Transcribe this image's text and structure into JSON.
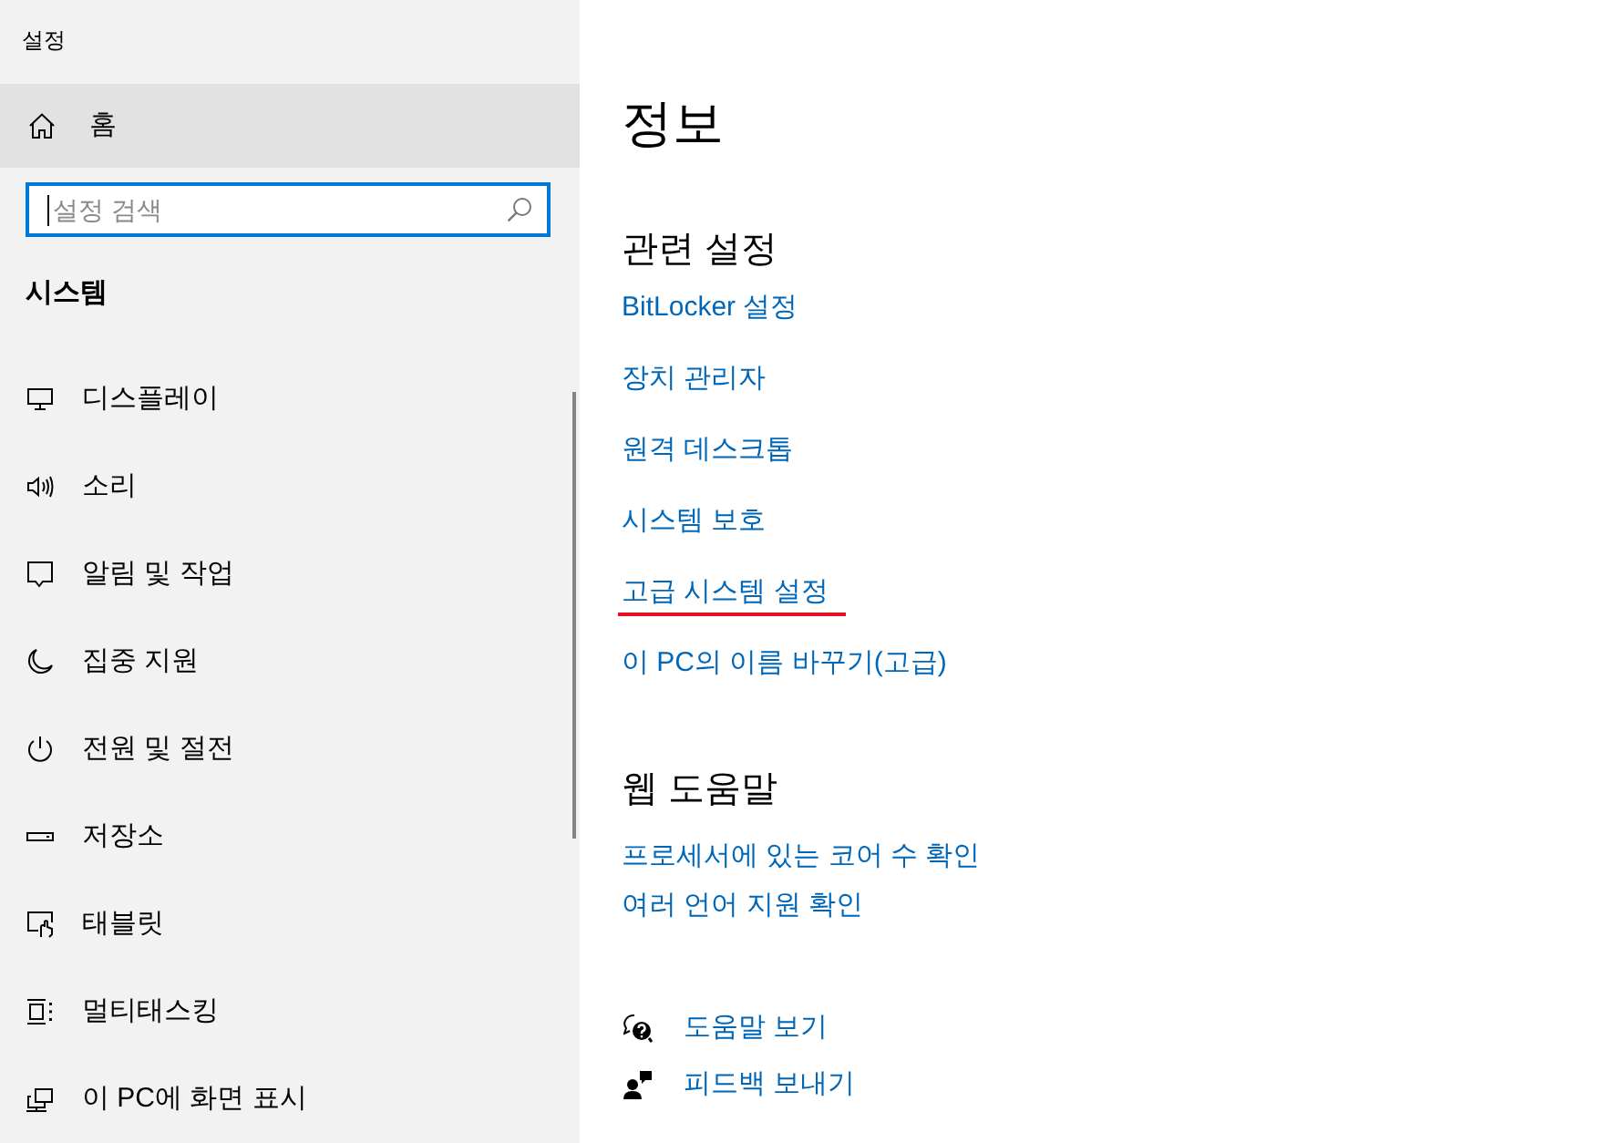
{
  "window": {
    "title": "설정"
  },
  "sidebar": {
    "home": {
      "label": "홈",
      "hovered": true
    },
    "search": {
      "placeholder": "설정 검색",
      "focused": true
    },
    "section": "시스템",
    "items": [
      {
        "label": "디스플레이",
        "kind": "display"
      },
      {
        "label": "소리",
        "kind": "sound"
      },
      {
        "label": "알림 및 작업",
        "kind": "notifications"
      },
      {
        "label": "집중 지원",
        "kind": "focus"
      },
      {
        "label": "전원 및 절전",
        "kind": "power"
      },
      {
        "label": "저장소",
        "kind": "storage"
      },
      {
        "label": "태블릿",
        "kind": "tablet"
      },
      {
        "label": "멀티태스킹",
        "kind": "multitasking"
      },
      {
        "label": "이 PC에 화면 표시",
        "kind": "projecting"
      }
    ]
  },
  "main": {
    "title": "정보",
    "sections": [
      {
        "heading": "관련 설정",
        "links": [
          {
            "label": "BitLocker 설정",
            "marked": false
          },
          {
            "label": "장치 관리자",
            "marked": false
          },
          {
            "label": "원격 데스크톱",
            "marked": false
          },
          {
            "label": "시스템 보호",
            "marked": false
          },
          {
            "label": "고급 시스템 설정",
            "marked": true
          },
          {
            "label": "이 PC의 이름 바꾸기(고급)",
            "marked": false
          }
        ]
      },
      {
        "heading": "웹 도움말",
        "links": [
          {
            "label": "프로세서에 있는 코어 수 확인",
            "marked": false
          },
          {
            "label": "여러 언어 지원 확인",
            "marked": false
          }
        ]
      }
    ],
    "help": [
      {
        "label": "도움말 보기",
        "kind": "help"
      },
      {
        "label": "피드백 보내기",
        "kind": "feedback"
      }
    ]
  }
}
